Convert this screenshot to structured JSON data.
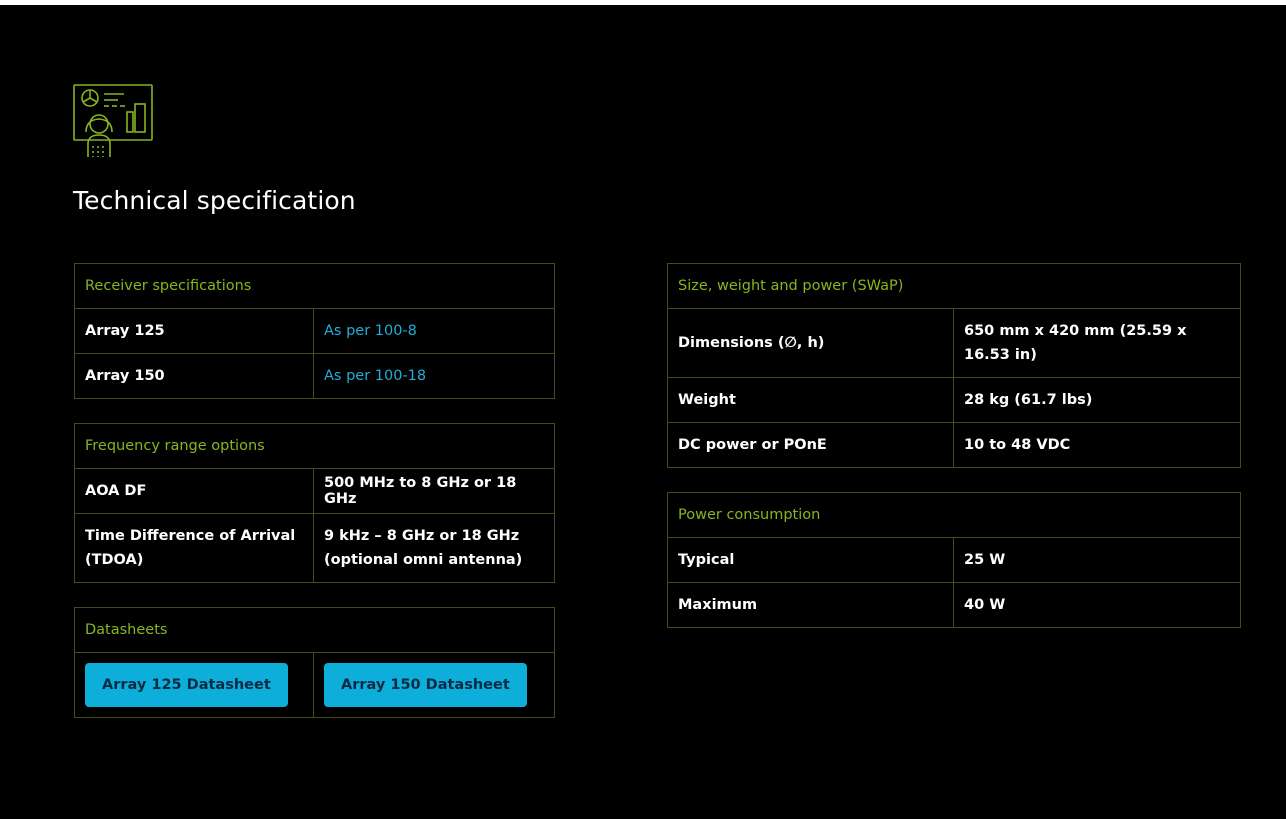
{
  "page": {
    "title": "Technical specification",
    "icon": "monitoring-operator-icon",
    "colors": {
      "background": "#000000",
      "accent_green": "#86b51f",
      "link_blue": "#1eaed6",
      "button_blue": "#0eaedb",
      "border": "#3f4f1a"
    }
  },
  "receiver": {
    "heading": "Receiver specifications",
    "rows": [
      {
        "label": "Array 125",
        "value": "As per 100-8"
      },
      {
        "label": "Array 150",
        "value": "As per 100-18"
      }
    ]
  },
  "frequency": {
    "heading": "Frequency range options",
    "rows": [
      {
        "label": "AOA DF",
        "value": "500 MHz to 8 GHz or 18 GHz"
      },
      {
        "label": "Time Difference of Arrival (TDOA)",
        "value": "9 kHz – 8 GHz or 18 GHz (optional omni antenna)"
      }
    ]
  },
  "datasheets": {
    "heading": "Datasheets",
    "buttons": [
      {
        "label": "Array 125 Datasheet"
      },
      {
        "label": "Array 150 Datasheet"
      }
    ]
  },
  "swap": {
    "heading": "Size, weight and power (SWaP)",
    "rows": [
      {
        "label": "Dimensions (∅, h)",
        "value": "650 mm x 420 mm (25.59 x 16.53 in)"
      },
      {
        "label": "Weight",
        "value": "28 kg (61.7 lbs)"
      },
      {
        "label": "DC power or POnE",
        "value": "10 to 48 VDC"
      }
    ]
  },
  "power": {
    "heading": "Power consumption",
    "rows": [
      {
        "label": "Typical",
        "value": "25 W"
      },
      {
        "label": "Maximum",
        "value": "40 W"
      }
    ]
  }
}
